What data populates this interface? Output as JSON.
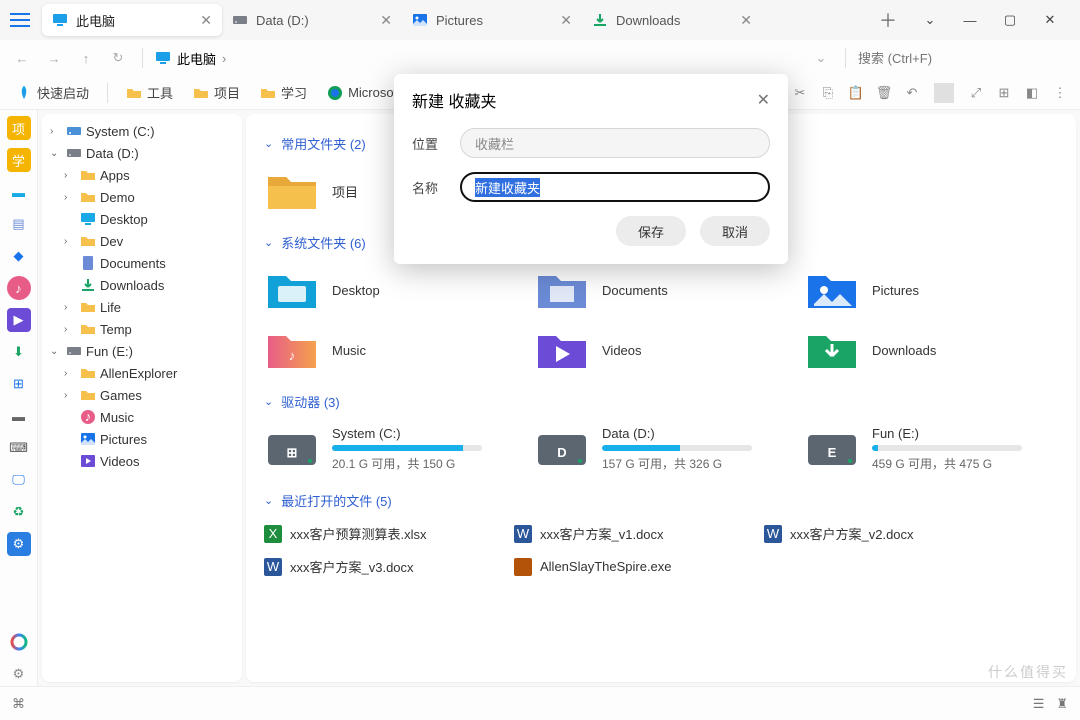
{
  "tabs": [
    {
      "label": "此电脑",
      "icon": "monitor",
      "active": true
    },
    {
      "label": "Data (D:)",
      "icon": "drive",
      "active": false
    },
    {
      "label": "Pictures",
      "icon": "pictures",
      "active": false
    },
    {
      "label": "Downloads",
      "icon": "downloads",
      "active": false
    }
  ],
  "nav": {
    "location": "此电脑"
  },
  "search": {
    "placeholder": "搜索 (Ctrl+F)"
  },
  "bookmarks": [
    {
      "icon": "rocket",
      "label": "快速启动"
    },
    {
      "icon": "folder",
      "label": "工具"
    },
    {
      "icon": "folder",
      "label": "项目"
    },
    {
      "icon": "folder",
      "label": "学习"
    },
    {
      "icon": "edge",
      "label": "Microsoft Edge"
    }
  ],
  "tree": [
    {
      "level": 0,
      "exp": ">",
      "icon": "drive-c",
      "label": "System (C:)"
    },
    {
      "level": 0,
      "exp": "v",
      "icon": "drive",
      "label": "Data (D:)"
    },
    {
      "level": 1,
      "exp": ">",
      "icon": "folder",
      "label": "Apps"
    },
    {
      "level": 1,
      "exp": ">",
      "icon": "folder",
      "label": "Demo"
    },
    {
      "level": 1,
      "exp": "",
      "icon": "desktop",
      "label": "Desktop"
    },
    {
      "level": 1,
      "exp": ">",
      "icon": "folder",
      "label": "Dev"
    },
    {
      "level": 1,
      "exp": "",
      "icon": "documents",
      "label": "Documents"
    },
    {
      "level": 1,
      "exp": "",
      "icon": "downloads",
      "label": "Downloads"
    },
    {
      "level": 1,
      "exp": ">",
      "icon": "folder",
      "label": "Life"
    },
    {
      "level": 1,
      "exp": ">",
      "icon": "folder",
      "label": "Temp"
    },
    {
      "level": 0,
      "exp": "v",
      "icon": "drive",
      "label": "Fun (E:)"
    },
    {
      "level": 1,
      "exp": ">",
      "icon": "folder",
      "label": "AllenExplorer"
    },
    {
      "level": 1,
      "exp": ">",
      "icon": "folder",
      "label": "Games"
    },
    {
      "level": 1,
      "exp": "",
      "icon": "music",
      "label": "Music"
    },
    {
      "level": 1,
      "exp": "",
      "icon": "pictures",
      "label": "Pictures"
    },
    {
      "level": 1,
      "exp": "",
      "icon": "videos",
      "label": "Videos"
    }
  ],
  "sections": {
    "favs": {
      "title": "常用文件夹 (2)",
      "items": [
        {
          "icon": "folder-big",
          "label": "项目"
        }
      ]
    },
    "sys": {
      "title": "系统文件夹 (6)",
      "items": [
        {
          "icon": "desktop-big",
          "label": "Desktop"
        },
        {
          "icon": "documents-big",
          "label": "Documents"
        },
        {
          "icon": "pictures-big",
          "label": "Pictures"
        },
        {
          "icon": "music-big",
          "label": "Music"
        },
        {
          "icon": "videos-big",
          "label": "Videos"
        },
        {
          "icon": "downloads-big",
          "label": "Downloads"
        }
      ]
    },
    "drives": {
      "title": "驱动器 (3)",
      "items": [
        {
          "letter": "⊞",
          "label": "System (C:)",
          "sub": "20.1 G 可用，共 150 G",
          "pct": 87
        },
        {
          "letter": "D",
          "label": "Data (D:)",
          "sub": "157 G 可用，共 326 G",
          "pct": 52
        },
        {
          "letter": "E",
          "label": "Fun (E:)",
          "sub": "459 G 可用，共 475 G",
          "pct": 4
        }
      ]
    },
    "recent": {
      "title": "最近打开的文件 (5)",
      "items": [
        {
          "icon": "xlsx",
          "label": "xxx客户预算测算表.xlsx"
        },
        {
          "icon": "docx",
          "label": "xxx客户方案_v1.docx"
        },
        {
          "icon": "docx",
          "label": "xxx客户方案_v2.docx"
        },
        {
          "icon": "docx",
          "label": "xxx客户方案_v3.docx"
        },
        {
          "icon": "exe",
          "label": "AllenSlayTheSpire.exe"
        }
      ]
    }
  },
  "dialog": {
    "title": "新建 收藏夹",
    "loc_label": "位置",
    "loc_value": "收藏栏",
    "name_label": "名称",
    "name_value": "新建收藏夹",
    "save": "保存",
    "cancel": "取消"
  },
  "watermark": "什么值得买"
}
